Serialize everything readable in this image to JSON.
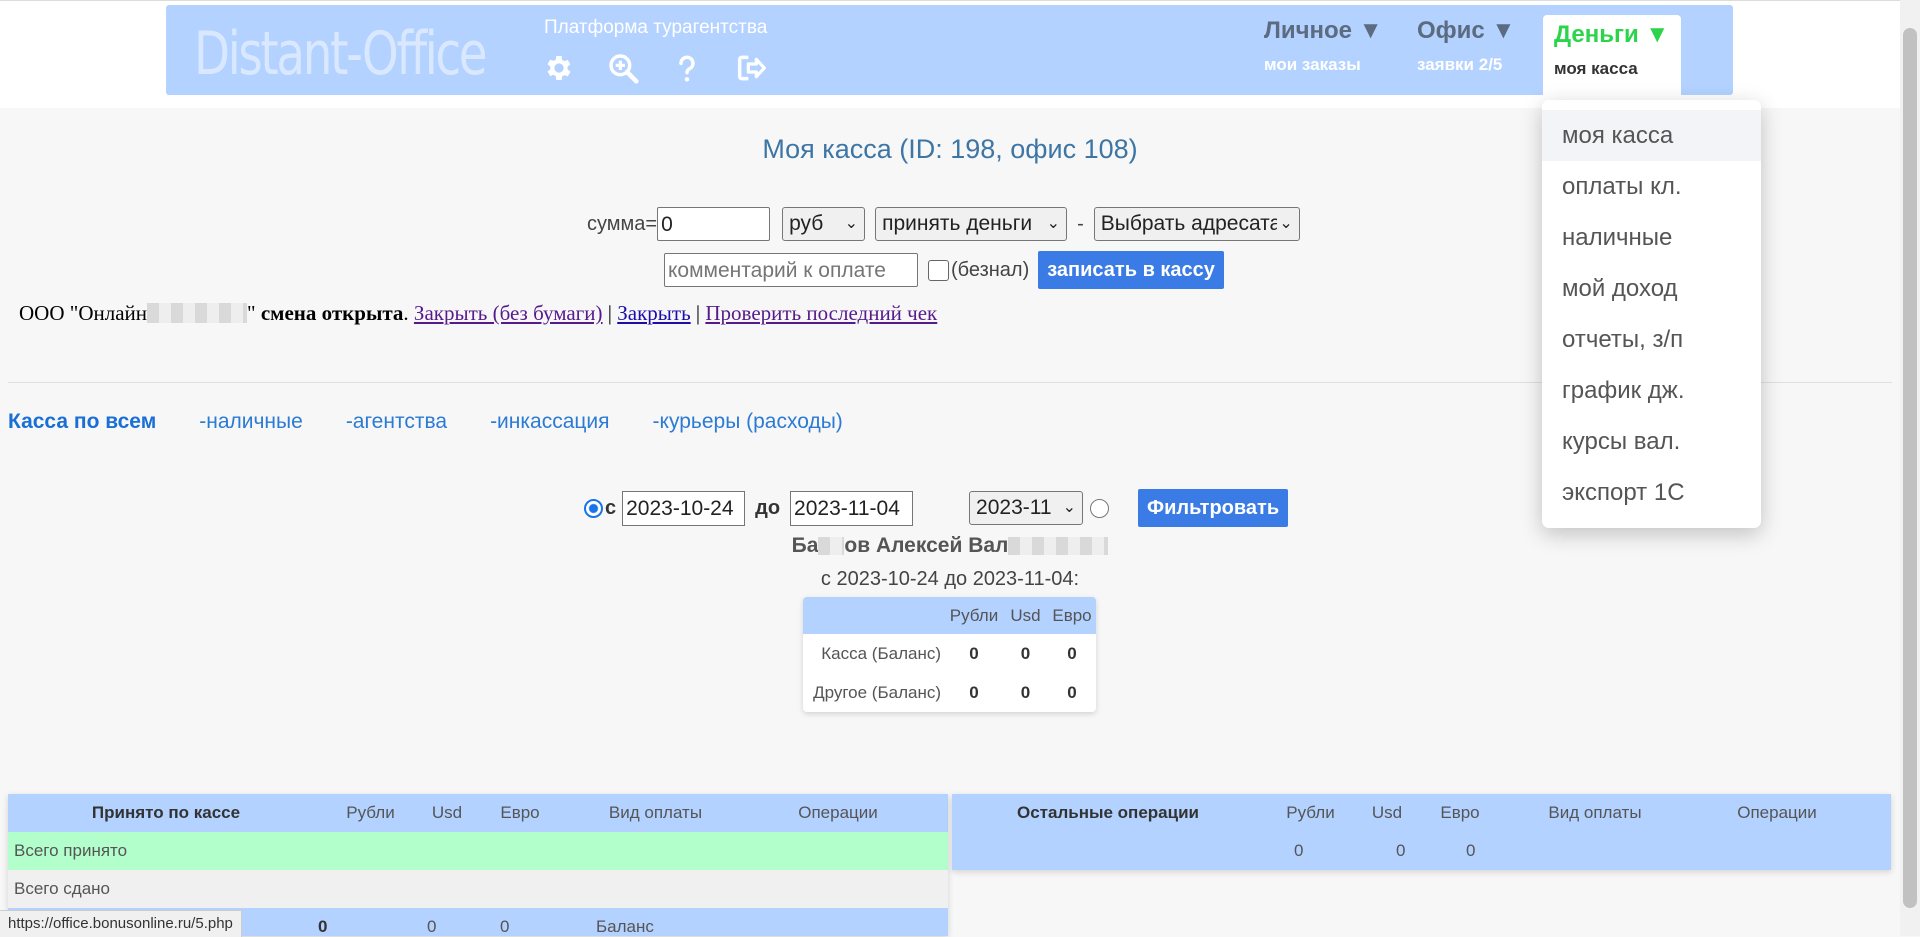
{
  "header": {
    "logo": "Distant-Office",
    "platform": "Платформа турагентства",
    "icons": [
      "gear-icon",
      "zoom-in-icon",
      "help-icon",
      "logout-icon"
    ],
    "menus": [
      {
        "title": "Личное ▼",
        "sub": "мои заказы"
      },
      {
        "title": "Офис ▼",
        "sub": "заявки 2/5"
      },
      {
        "title": "Деньги ▼",
        "sub": "моя касса"
      }
    ]
  },
  "dropdown": {
    "items": [
      "моя касса",
      "оплаты кл.",
      "наличные",
      "мой доход",
      "отчеты, з/п",
      "график дж.",
      "курсы вал.",
      "экспорт 1С"
    ]
  },
  "page": {
    "title": "Моя касса (ID: 198, офис 108)"
  },
  "form": {
    "sum_label": "сумма=",
    "sum_value": "0",
    "currency": "руб",
    "action": "принять деньги",
    "dash": "-",
    "recipient": "Выбрать адресата",
    "comment_placeholder": "комментарий к оплате",
    "cashless_label": "(безнал)",
    "submit": "записать в кассу"
  },
  "status": {
    "org_prefix": "ООО \"Онлайн",
    "org_suffix": "\"",
    "shift": "смена открыта",
    "dot": ".",
    "close_nopaper": "Закрыть (без бумаги)",
    "sep": "|",
    "close": "Закрыть",
    "check_last": "Проверить последний чек"
  },
  "tabs": [
    "Касса по всем",
    "-наличные",
    "-агентства",
    "-инкассация",
    "-курьеры (расходы)"
  ],
  "filter": {
    "from_label": "с",
    "from": "2023-10-24",
    "to_label": "до",
    "to": "2023-11-04",
    "month": "2023-11",
    "button": "Фильтровать"
  },
  "person": {
    "name_a": "Ба",
    "name_b": "ов Алексей Вал"
  },
  "period": "с 2023-10-24 до 2023-11-04:",
  "summary": {
    "headers": [
      "",
      "Рубли",
      "Usd",
      "Евро"
    ],
    "rows": [
      {
        "label": "Касса (Баланс)",
        "rub": "0",
        "usd": "0",
        "eur": "0"
      },
      {
        "label": "Другое (Баланс)",
        "rub": "0",
        "usd": "0",
        "eur": "0"
      }
    ]
  },
  "left_table": {
    "headers": [
      "Принято по кассе",
      "Рубли",
      "Usd",
      "Евро",
      "Вид оплаты",
      "Операции"
    ],
    "rows": [
      {
        "label": "Всего принято"
      },
      {
        "label": "Всего сдано"
      },
      {
        "label": "",
        "rub": "0",
        "usd": "0",
        "eur": "0",
        "type": "Баланс"
      }
    ],
    "colors": {
      "accepted": "#b3ffcc",
      "handed": "#f0f0f0",
      "balance": "#b3d2ff"
    }
  },
  "right_table": {
    "headers": [
      "Остальные операции",
      "Рубли",
      "Usd",
      "Евро",
      "Вид оплаты",
      "Операции"
    ],
    "rows": [
      {
        "rub": "0",
        "usd": "0",
        "eur": "0"
      }
    ]
  },
  "statusbar": "https://office.bonusonline.ru/5.php",
  "colors": {
    "header_bg": "#b3d2ff",
    "accent_green": "#2bd44a",
    "button_blue": "#3b7be6",
    "title_blue": "#3d76a5"
  }
}
